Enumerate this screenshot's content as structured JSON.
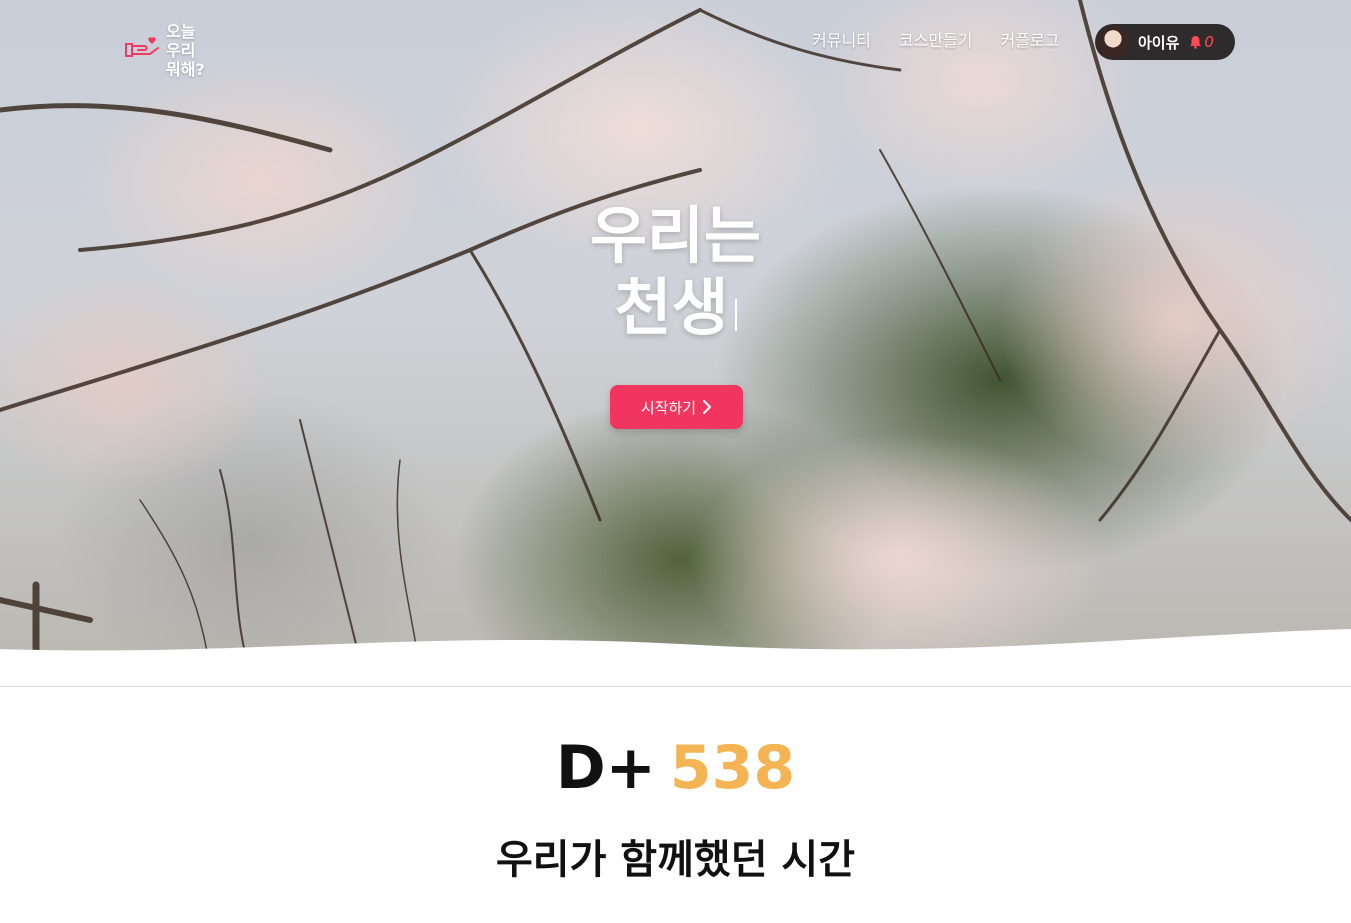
{
  "logo": {
    "lines": [
      "오늘",
      "우리",
      "뭐해?"
    ]
  },
  "nav": {
    "links": [
      "커뮤니티",
      "코스만들기",
      "커플로그"
    ],
    "user": {
      "name": "아이유",
      "notification_count": "0"
    }
  },
  "hero": {
    "headline_line1": "우리는",
    "headline_line2": "천생",
    "start_button": "시작하기"
  },
  "counter": {
    "prefix": "D+",
    "value": "538"
  },
  "section": {
    "subtitle": "우리가 함께했던 시간"
  },
  "colors": {
    "accent_button": "#f0365f",
    "dday_value": "#f5b453",
    "user_pill": "#2d2b2c",
    "bell": "#ff4a57"
  },
  "icons": [
    "logo-heart-hand-icon",
    "bell-icon",
    "chevron-right-icon"
  ]
}
